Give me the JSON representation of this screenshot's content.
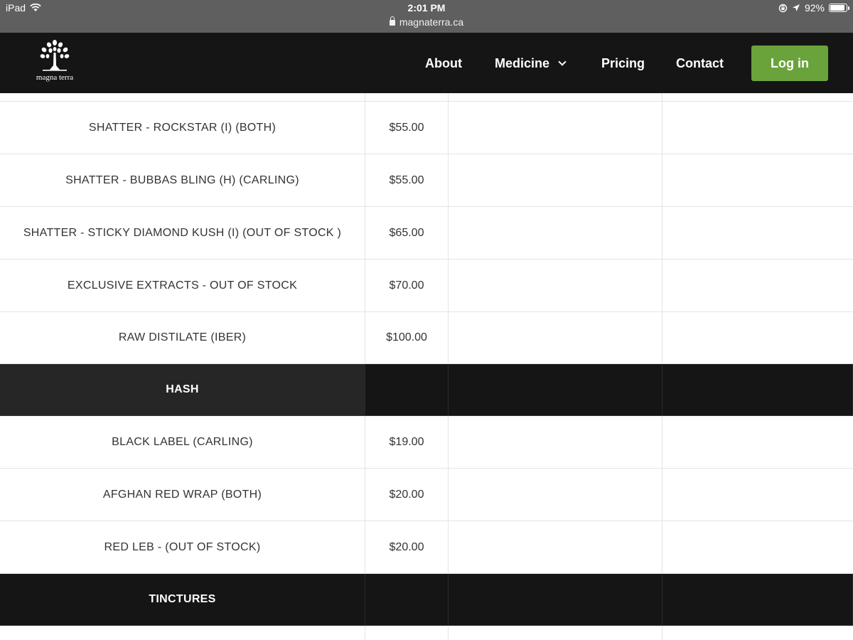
{
  "statusbar": {
    "device": "iPad",
    "time": "2:01 PM",
    "url": "magnaterra.ca",
    "battery": "92%",
    "battery_level": 0.92
  },
  "header": {
    "logo_text": "magna terra",
    "nav": [
      "About",
      "Medicine",
      "Pricing",
      "Contact"
    ],
    "login_label": "Log in",
    "accent_color": "#6aa33b"
  },
  "table": {
    "rows": [
      {
        "type": "item",
        "name": "",
        "price": ""
      },
      {
        "type": "item",
        "name": "SHATTER - ROCKSTAR (I) (BOTH)",
        "price": "$55.00"
      },
      {
        "type": "item",
        "name": "SHATTER - BUBBAS BLING (H) (CARLING)",
        "price": "$55.00"
      },
      {
        "type": "item",
        "name": "SHATTER - STICKY DIAMOND KUSH (I) (OUT OF STOCK )",
        "price": "$65.00"
      },
      {
        "type": "item",
        "name": "EXCLUSIVE EXTRACTS - OUT OF STOCK",
        "price": "$70.00"
      },
      {
        "type": "item",
        "name": "RAW DISTILATE (IBER)",
        "price": "$100.00"
      },
      {
        "type": "section",
        "name": "HASH",
        "price": ""
      },
      {
        "type": "item",
        "name": "BLACK LABEL (CARLING)",
        "price": "$19.00"
      },
      {
        "type": "item",
        "name": "AFGHAN RED WRAP (BOTH)",
        "price": "$20.00"
      },
      {
        "type": "item",
        "name": "RED LEB - (OUT OF STOCK)",
        "price": "$20.00"
      },
      {
        "type": "section",
        "name": "TINCTURES",
        "price": ""
      },
      {
        "type": "item",
        "name": "",
        "price": ""
      }
    ]
  }
}
